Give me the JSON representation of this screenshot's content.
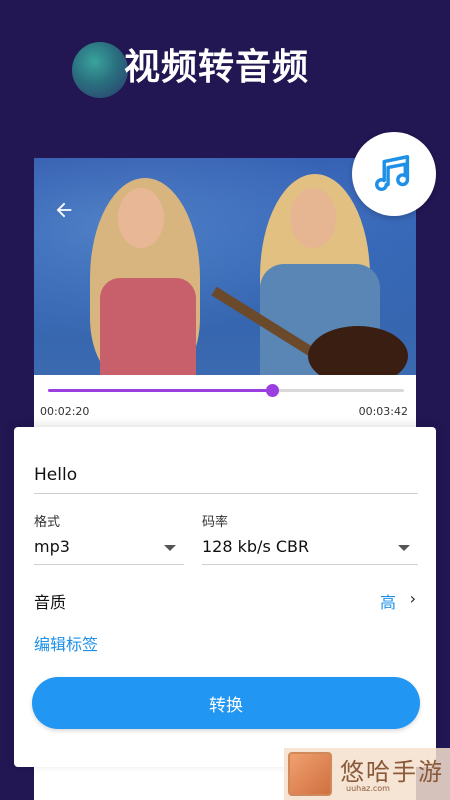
{
  "header": {
    "title": "视频转音频"
  },
  "player": {
    "back_icon": "arrow-left-icon",
    "badge_icon": "music-note-icon",
    "progress": 0.63,
    "current_time": "00:02:20",
    "total_time": "00:03:42",
    "accent": "#9b3fe0"
  },
  "form": {
    "filename_value": "Hello",
    "format": {
      "label": "格式",
      "selected": "mp3"
    },
    "bitrate": {
      "label": "码率",
      "selected": "128 kb/s CBR"
    },
    "quality": {
      "label": "音质",
      "value": "高",
      "chevron": "›"
    },
    "edit_tags_label": "编辑标签",
    "convert_label": "转换",
    "accent": "#2196f3"
  },
  "watermark": {
    "text": "悠哈手游",
    "url": "uuhaz.com"
  }
}
